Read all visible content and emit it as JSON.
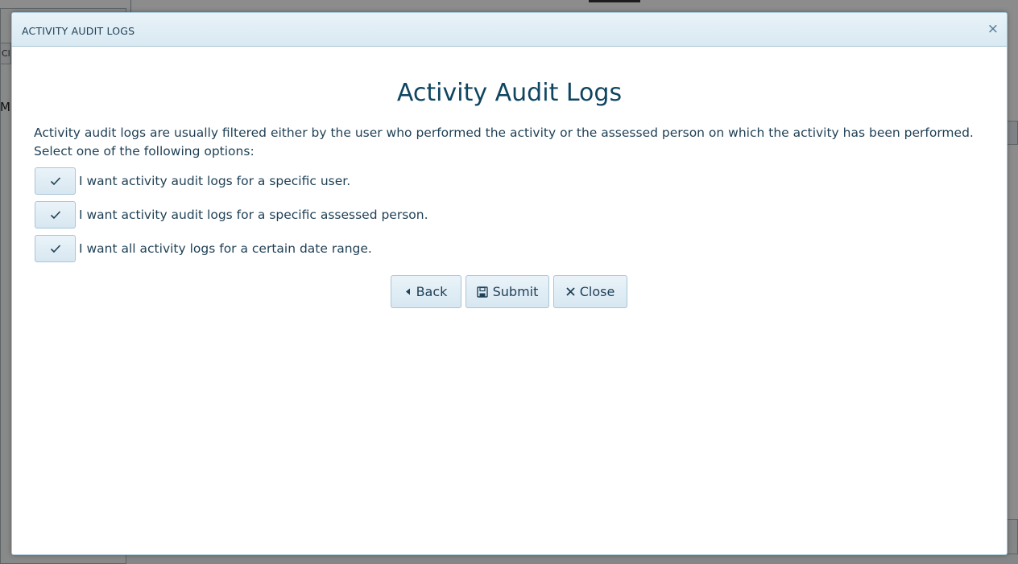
{
  "background": {
    "tab_stub_text": "Cle",
    "side_text": "Ma"
  },
  "dialog": {
    "title": "ACTIVITY AUDIT LOGS",
    "close_icon": "×",
    "heading": "Activity Audit Logs",
    "intro": "Activity audit logs are usually filtered either by the user who performed the activity or the assessed person on which the activity has been performed. Select one of the following options:",
    "options": [
      {
        "label": "I want activity audit logs for a specific user.",
        "icon": "checkmark-icon"
      },
      {
        "label": "I want activity audit logs for a specific assessed person.",
        "icon": "checkmark-icon"
      },
      {
        "label": "I want all activity logs for a certain date range.",
        "icon": "checkmark-icon"
      }
    ],
    "buttons": {
      "back": {
        "label": "Back",
        "icon": "caret-left-icon"
      },
      "submit": {
        "label": "Submit",
        "icon": "save-icon"
      },
      "close": {
        "label": "Close",
        "icon": "close-icon"
      }
    }
  },
  "colors": {
    "accent": "#0f4560",
    "text": "#1e3f55",
    "border": "#a9c5d6",
    "header_bg": "#d9e9f2"
  }
}
